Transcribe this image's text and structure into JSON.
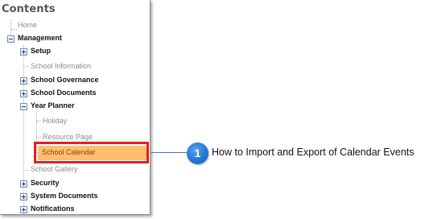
{
  "panel": {
    "title": "Contents",
    "tree": {
      "home": "Home",
      "management": "Management",
      "setup": "Setup",
      "school_information": "School Information",
      "school_governance": "School Governance",
      "school_documents": "School Documents",
      "year_planner": "Year Planner",
      "holiday": "Holiday",
      "resource_page": "Resource Page",
      "school_calendar": "School Calendar",
      "school_gallery": "School Gallery",
      "security": "Security",
      "system_documents": "System Documents",
      "notifications": "Notifications"
    }
  },
  "callout": {
    "number": "1",
    "text": "How to Import and Export of Calendar Events"
  },
  "colors": {
    "highlight_border": "#e11f26",
    "selected_background": "#ffbe6e",
    "callout_badge": "#2277d8",
    "connector_line": "#3a79c4"
  },
  "icons": {
    "expand": "plus-box-icon",
    "collapse": "minus-box-icon"
  }
}
